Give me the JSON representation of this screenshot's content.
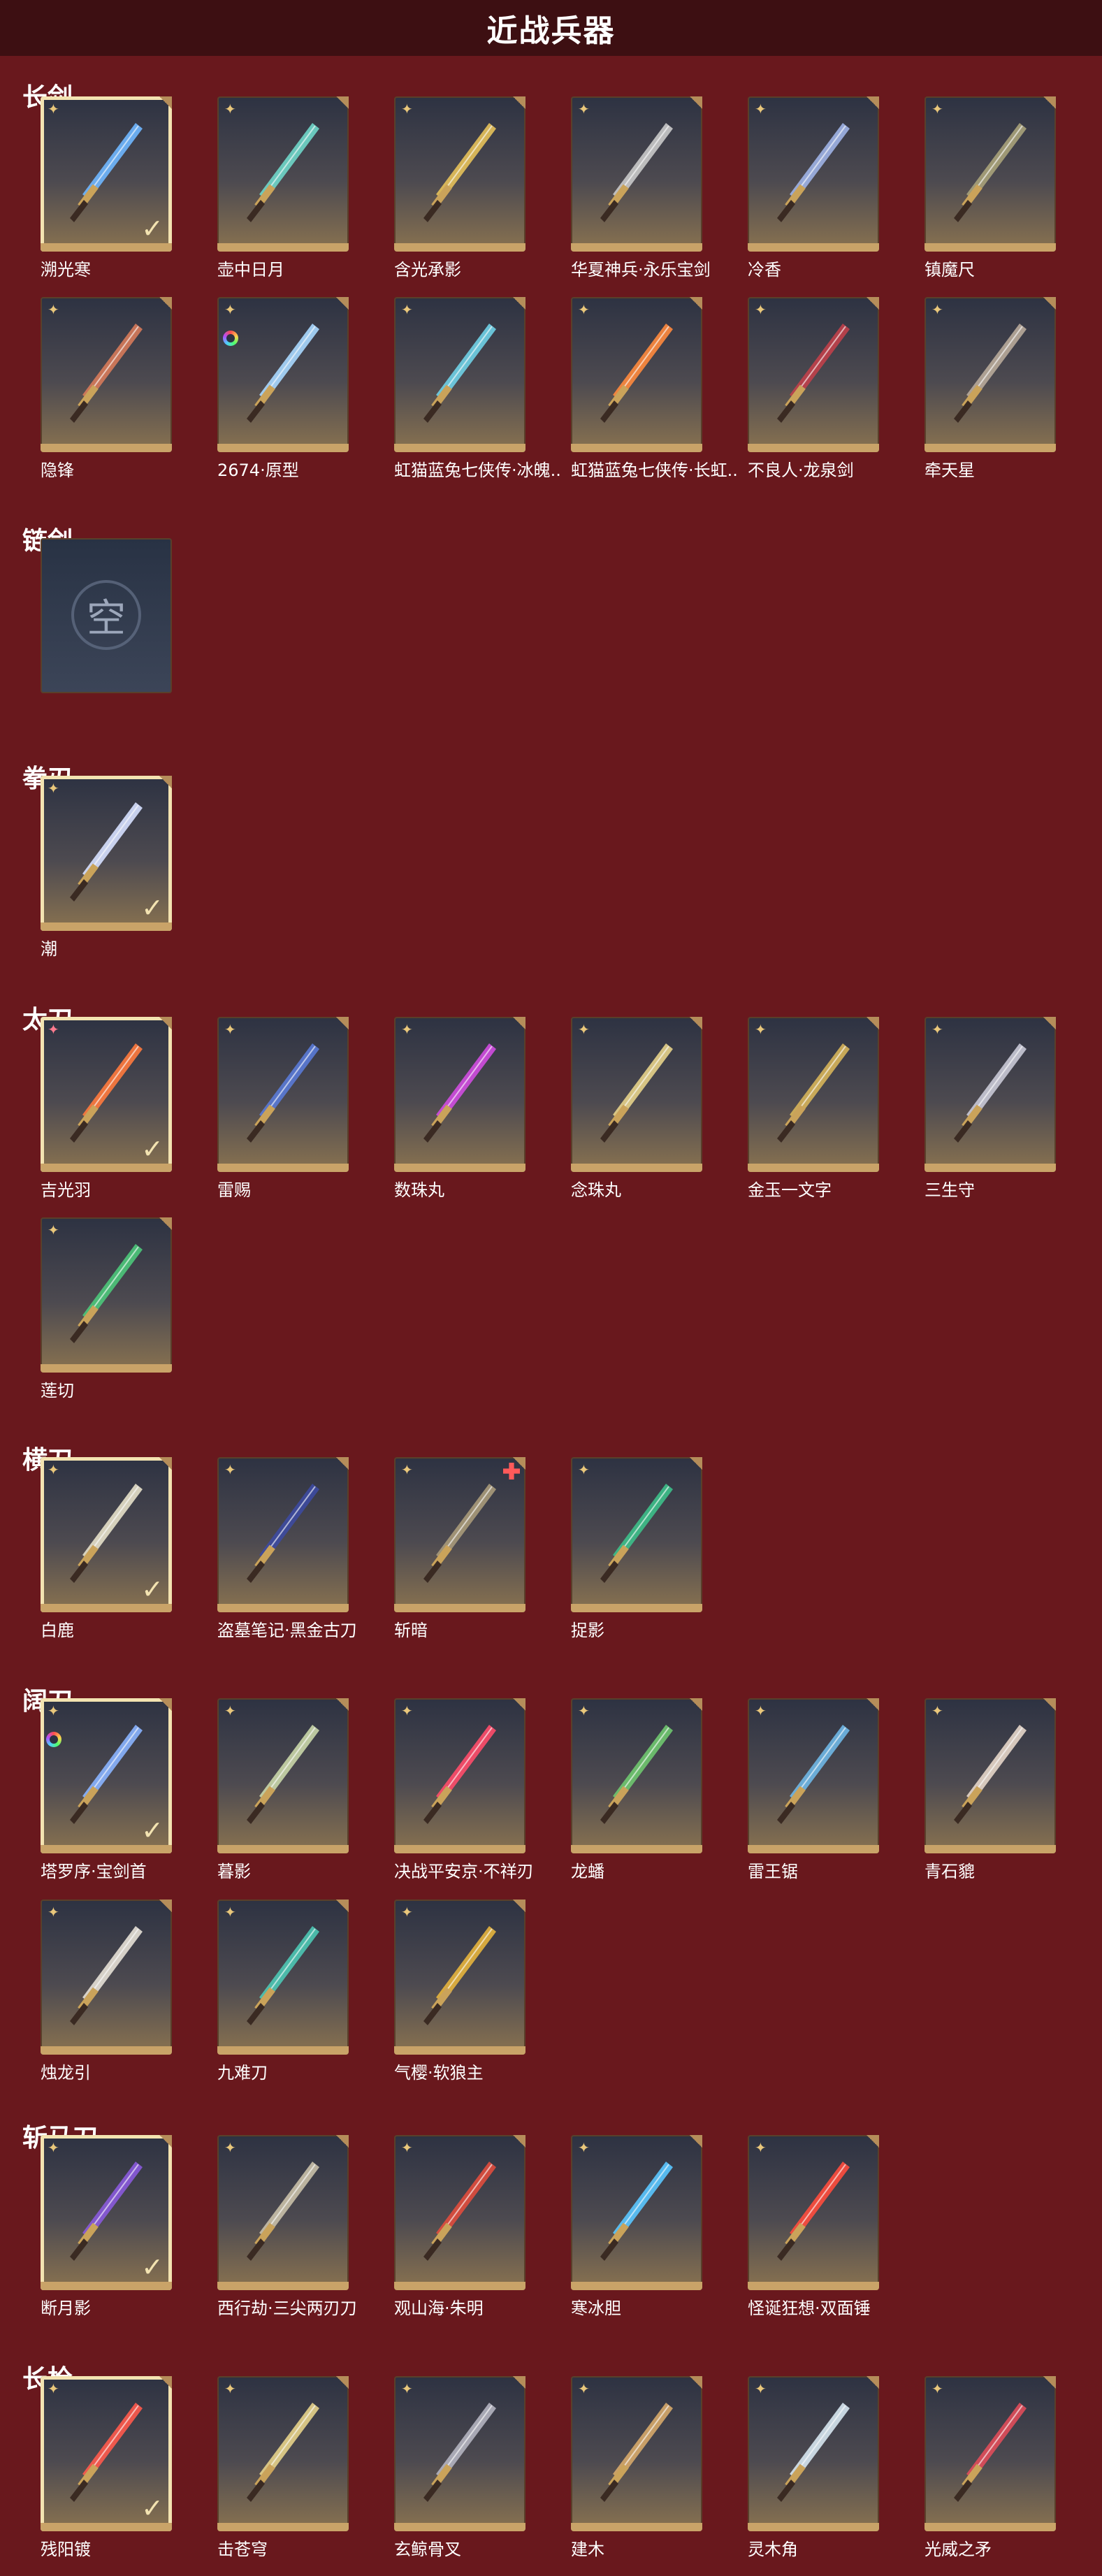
{
  "page_title": "近战兵器",
  "colors": {
    "background": "#69181d",
    "topbar": "#3d0f12",
    "accent": "#c9a368",
    "selected_border": "#f3e3b1"
  },
  "sections": [
    {
      "name": "长剑",
      "items": [
        {
          "name": "溯光寒",
          "selected": true,
          "badge": "star",
          "color": "#6fb7ff"
        },
        {
          "name": "壶中日月",
          "badge": "star",
          "color": "#6fd6c9"
        },
        {
          "name": "含光承影",
          "badge": "star",
          "color": "#e6c15a"
        },
        {
          "name": "华夏神兵·永乐宝剑",
          "badge": "star",
          "color": "#c9c9c9"
        },
        {
          "name": "冷香",
          "badge": "star",
          "color": "#9fb2e6"
        },
        {
          "name": "镇魔尺",
          "badge": "star",
          "color": "#a8a27a"
        },
        {
          "name": "隐锋",
          "badge": "star",
          "color": "#d67a5a"
        },
        {
          "name": "2674·原型",
          "badge": "star",
          "extra_badge": "rainbow",
          "color": "#a9d8ff"
        },
        {
          "name": "虹猫蓝兔七侠传·冰魄..",
          "badge": "star",
          "color": "#6fd0e6"
        },
        {
          "name": "虹猫蓝兔七侠传·长虹..",
          "badge": "star",
          "color": "#ff8a3d"
        },
        {
          "name": "不良人·龙泉剑",
          "badge": "star",
          "color": "#c0404a"
        },
        {
          "name": "牵天星",
          "badge": "star",
          "color": "#b8aa9a"
        }
      ]
    },
    {
      "name": "链剑",
      "items": [
        {
          "name": "",
          "empty": true,
          "placeholder": "空"
        }
      ]
    },
    {
      "name": "拳刃",
      "items": [
        {
          "name": "潮",
          "selected": true,
          "badge": "star",
          "color": "#d6e0ff"
        }
      ]
    },
    {
      "name": "太刀",
      "items": [
        {
          "name": "吉光羽",
          "selected": true,
          "badge": "star-pink",
          "color": "#ff7a3d"
        },
        {
          "name": "雷赐",
          "badge": "star",
          "color": "#5a7ad6"
        },
        {
          "name": "数珠丸",
          "badge": "star",
          "color": "#d04de0"
        },
        {
          "name": "念珠丸",
          "badge": "star",
          "color": "#e6d28a"
        },
        {
          "name": "金玉一文字",
          "badge": "star",
          "color": "#d6b45a"
        },
        {
          "name": "三生守",
          "badge": "star",
          "color": "#c9c9d6"
        },
        {
          "name": "莲切",
          "badge": "star",
          "color": "#4dc77a"
        }
      ]
    },
    {
      "name": "横刀",
      "items": [
        {
          "name": "白鹿",
          "selected": true,
          "badge": "star",
          "color": "#e6e0c9"
        },
        {
          "name": "盗墓笔记·黑金古刀",
          "badge": "star",
          "color": "#3d4aa0"
        },
        {
          "name": "斩暗",
          "badge": "star",
          "extra_badge": "cross",
          "color": "#a89a7a"
        },
        {
          "name": "捉影",
          "badge": "star",
          "color": "#3dbf8a"
        }
      ]
    },
    {
      "name": "阔刀",
      "items": [
        {
          "name": "塔罗序·宝剑首",
          "selected": true,
          "badge": "star",
          "extra_badge": "rainbow",
          "color": "#8ab4ff"
        },
        {
          "name": "暮影",
          "badge": "star",
          "color": "#c9d6a8"
        },
        {
          "name": "决战平安京·不祥刃",
          "badge": "star",
          "color": "#ff4d6a"
        },
        {
          "name": "龙蟠",
          "badge": "star",
          "color": "#6fc76f"
        },
        {
          "name": "雷王锯",
          "badge": "star",
          "color": "#6fb7e6"
        },
        {
          "name": "青石貔",
          "badge": "star",
          "color": "#e6d6c9"
        },
        {
          "name": "烛龙引",
          "badge": "star",
          "color": "#e6e0d6"
        },
        {
          "name": "九难刀",
          "badge": "star",
          "color": "#4dc7b4"
        },
        {
          "name": "气樱·软狼主",
          "badge": "star",
          "color": "#e6b43d"
        }
      ]
    },
    {
      "name": "斩马刀",
      "items": [
        {
          "name": "断月影",
          "selected": true,
          "badge": "star",
          "color": "#8a5adb"
        },
        {
          "name": "西行劫·三尖两刃刀",
          "badge": "star",
          "color": "#c9c0a8"
        },
        {
          "name": "观山海·朱明",
          "badge": "star",
          "color": "#e04d3d"
        },
        {
          "name": "寒冰胆",
          "badge": "star",
          "color": "#5ac7ff"
        },
        {
          "name": "怪诞狂想·双面锤",
          "badge": "star",
          "color": "#ff4d3d"
        }
      ]
    },
    {
      "name": "长枪",
      "items": [
        {
          "name": "残阳镀",
          "selected": true,
          "badge": "star",
          "color": "#ff5a4d"
        },
        {
          "name": "击苍穹",
          "badge": "star",
          "color": "#e6d28a"
        },
        {
          "name": "玄鲸骨叉",
          "badge": "star",
          "color": "#b4b4c0"
        },
        {
          "name": "建木",
          "badge": "star",
          "color": "#d6a86a"
        },
        {
          "name": "灵木角",
          "badge": "star",
          "color": "#d6e6f0"
        },
        {
          "name": "光威之矛",
          "badge": "star",
          "color": "#e04d5a"
        }
      ]
    }
  ]
}
